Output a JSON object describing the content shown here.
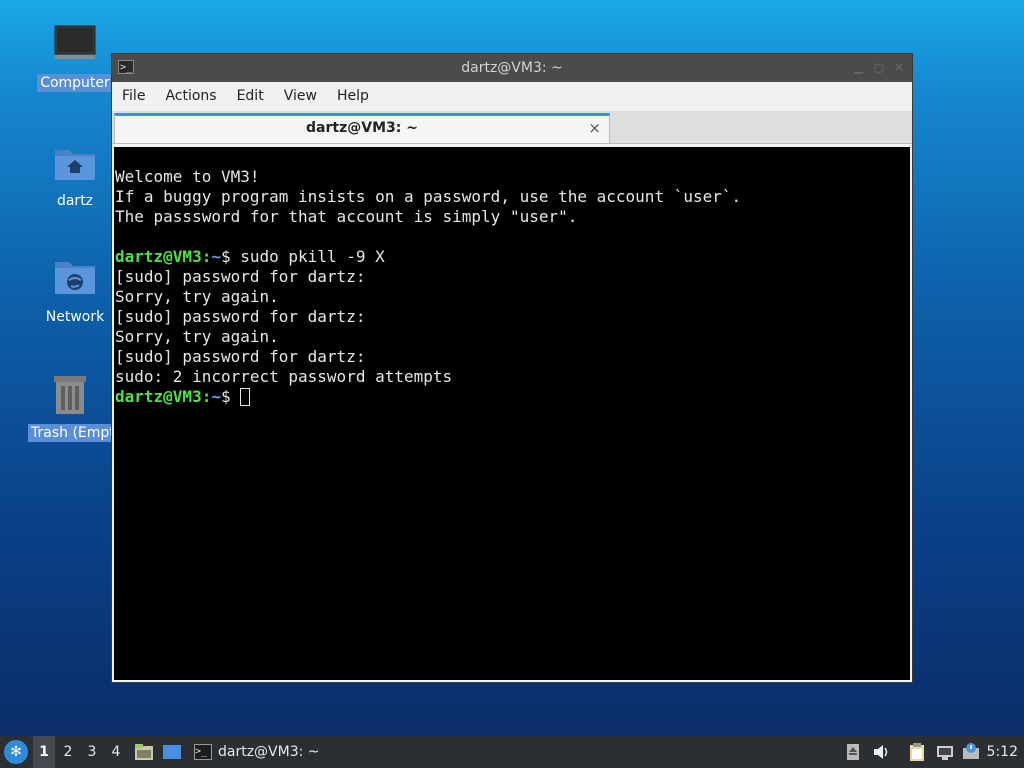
{
  "desktop": {
    "icons": [
      {
        "label": "Computer",
        "icon": "computer-icon"
      },
      {
        "label": "dartz",
        "icon": "home-folder-icon"
      },
      {
        "label": "Network",
        "icon": "network-folder-icon"
      },
      {
        "label": "Trash (Empt",
        "icon": "trash-icon"
      }
    ]
  },
  "window": {
    "title": "dartz@VM3: ~",
    "menu": [
      "File",
      "Actions",
      "Edit",
      "View",
      "Help"
    ],
    "tab": {
      "label": "dartz@VM3: ~",
      "close": "×"
    }
  },
  "terminal": {
    "welcome": [
      "Welcome to VM3!",
      "If a buggy program insists on a password, use the account `user`.",
      "The passsword for that account is simply \"user\"."
    ],
    "prompt_user": "dartz@VM3",
    "prompt_sep": ":",
    "prompt_path": "~",
    "prompt_symbol": "$ ",
    "command": "sudo pkill -9 X",
    "output": [
      "[sudo] password for dartz:",
      "Sorry, try again.",
      "[sudo] password for dartz:",
      "Sorry, try again.",
      "[sudo] password for dartz:",
      "sudo: 2 incorrect password attempts"
    ]
  },
  "taskbar": {
    "workspaces": [
      "1",
      "2",
      "3",
      "4"
    ],
    "active_workspace": "1",
    "task_label": "dartz@VM3: ~",
    "clock": "5:12"
  },
  "colors": {
    "prompt_user": "#4fe04a",
    "prompt_path": "#5aa4f0",
    "tab_accent": "#3d8ee6",
    "selection": "#5a8fd6"
  }
}
